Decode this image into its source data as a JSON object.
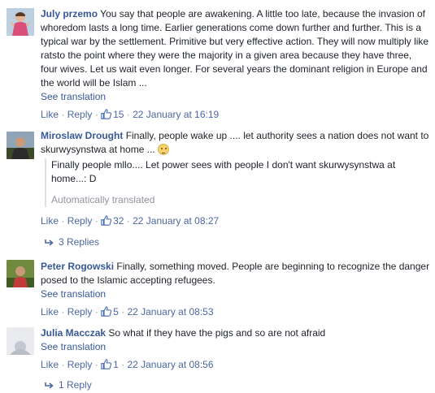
{
  "actions": {
    "like": "Like",
    "reply": "Reply",
    "see_translation": "See translation",
    "sep": "·"
  },
  "comments": [
    {
      "author": "July przemo",
      "text": "You say that people are awakening. A little too late, because the invasion of whoredom lasts a long time. Earlier generations come down further and further. This is a typical war by the settlement. Primitive but very effective action. They will now multiply like ratsto the point where they were the majority in a given area because they have three, four wives. Let us wait even longer. For several years the dominant religion in Europe and the world will be Islam ...",
      "likes": "15",
      "time": "22 January at 16:19"
    },
    {
      "author": "Miroslaw Drought",
      "text": "Finally, people wake up .... let authority sees a nation does not want to skurwysynstwa at home ...",
      "translated": "Finally people mllo.... Let power sees with people I don't want skurwysynstwa at home...: D",
      "auto_label": "Automatically translated",
      "likes": "32",
      "time": "22 January at 08:27",
      "replies": "3 Replies"
    },
    {
      "author": "Peter Rogowski",
      "text": "Finally, something moved. People are beginning to recognize the danger posed to the Islamic accepting refugees.",
      "likes": "5",
      "time": "22 January at 08:53"
    },
    {
      "author": "Julia Macczak",
      "text": "So what if they have the pigs and so are not afraid",
      "likes": "1",
      "time": "22 January at 08:56",
      "replies": "1 Reply"
    }
  ],
  "colors": {
    "link": "#365899",
    "meta": "#90949c",
    "like_blue": "#4267b2"
  },
  "icons": [
    "thumbs-up-icon",
    "reply-arrow-icon",
    "smiley-emoji-icon"
  ]
}
